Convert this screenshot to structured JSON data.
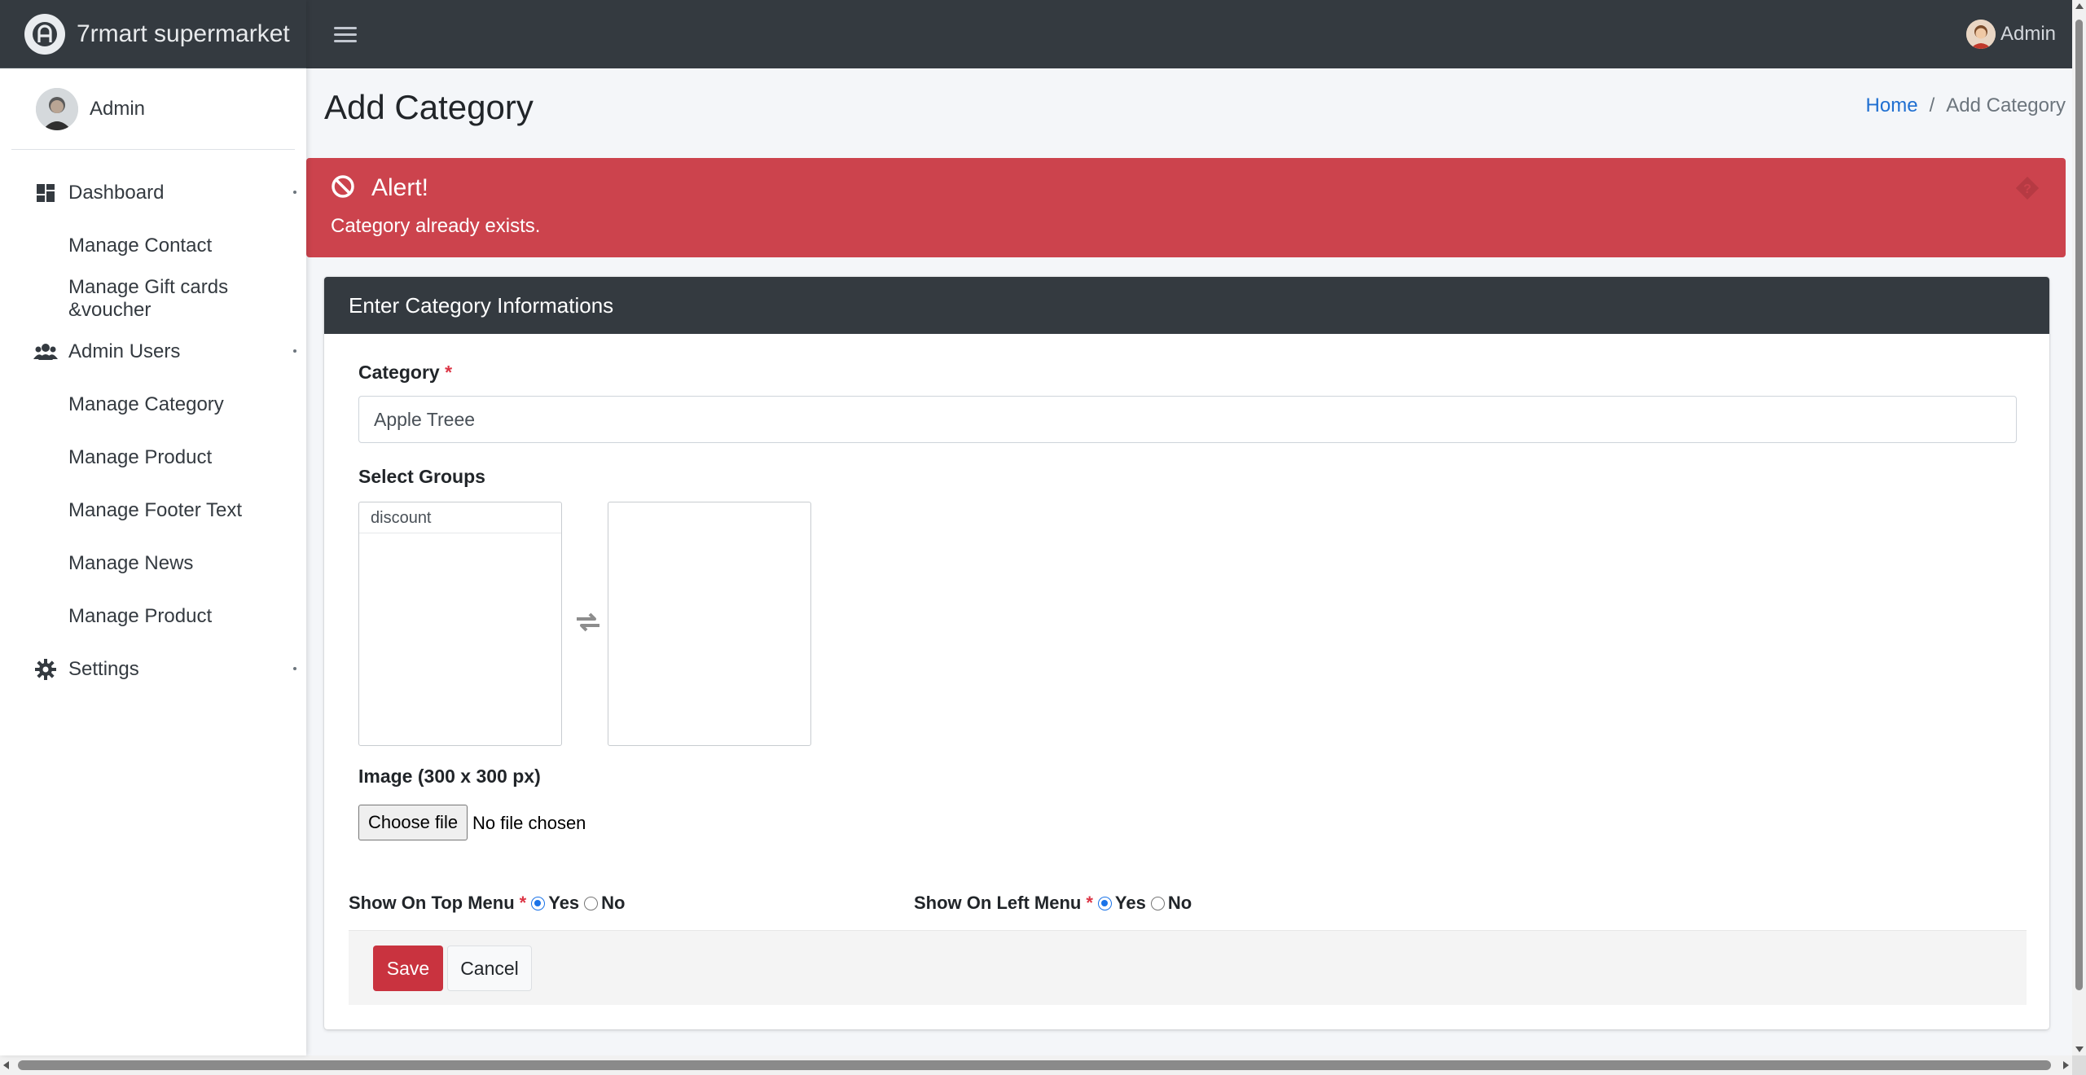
{
  "brand": {
    "name": "7rmart supermarket",
    "logo_icon": "brand-logo-icon"
  },
  "topbar": {
    "user_name": "Admin",
    "menu_icon": "hamburger-icon"
  },
  "sidebar": {
    "user_name": "Admin",
    "items": [
      {
        "label": "Dashboard",
        "icon": "dashboard-icon",
        "type": "main"
      },
      {
        "label": "Manage Contact",
        "type": "sub"
      },
      {
        "label": "Manage Gift cards &voucher",
        "type": "sub"
      },
      {
        "label": "Admin Users",
        "icon": "users-icon",
        "type": "main"
      },
      {
        "label": "Manage Category",
        "type": "sub"
      },
      {
        "label": "Manage Product",
        "type": "sub"
      },
      {
        "label": "Manage Footer Text",
        "type": "sub"
      },
      {
        "label": "Manage News",
        "type": "sub"
      },
      {
        "label": "Manage Product",
        "type": "sub"
      },
      {
        "label": "Settings",
        "icon": "gear-icon",
        "type": "main"
      }
    ]
  },
  "page": {
    "title": "Add Category",
    "breadcrumb": {
      "home": "Home",
      "separator": "/",
      "current": "Add Category"
    }
  },
  "alert": {
    "title": "Alert!",
    "message": "Category already exists.",
    "color": "#cc434d"
  },
  "form": {
    "header": "Enter Category Informations",
    "category_label": "Category",
    "required_mark": "*",
    "category_value": "Apple Treee",
    "groups_label": "Select Groups",
    "groups_available": [
      "discount"
    ],
    "groups_selected": [],
    "image_label": "Image (300 x 300 px)",
    "file_button": "Choose file",
    "file_status": "No file chosen",
    "top_menu": {
      "label": "Show On Top Menu",
      "yes": "Yes",
      "no": "No",
      "selected": "Yes"
    },
    "left_menu": {
      "label": "Show On Left Menu",
      "yes": "Yes",
      "no": "No",
      "selected": "Yes"
    },
    "save_label": "Save",
    "cancel_label": "Cancel"
  },
  "colors": {
    "navbar": "#343a40",
    "primary_link": "#1f6fd1",
    "danger": "#c9333f"
  }
}
